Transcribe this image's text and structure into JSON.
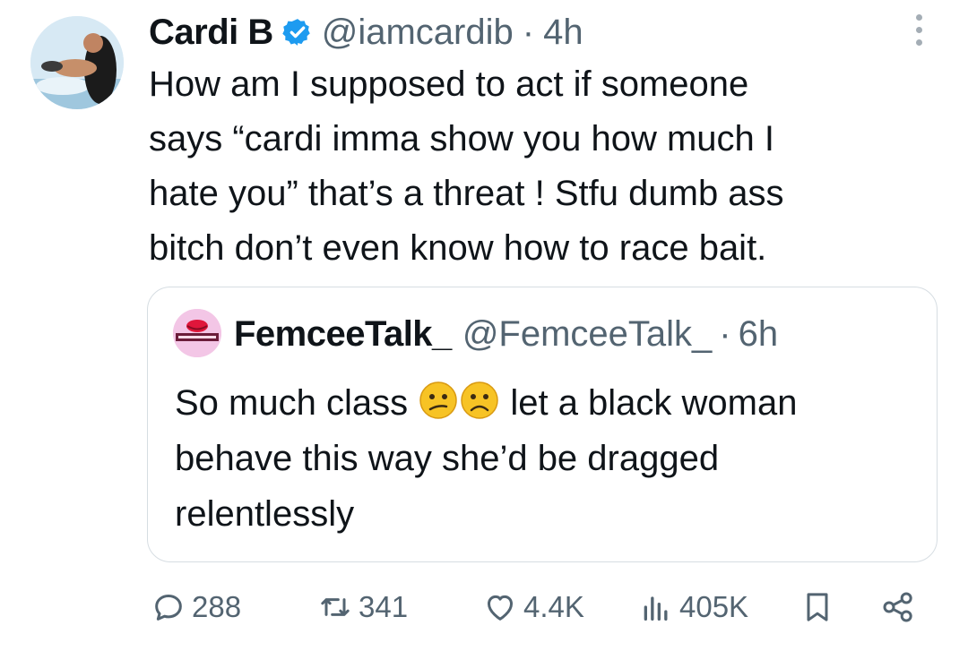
{
  "tweet": {
    "author_name": "Cardi B",
    "handle": "@iamcardib",
    "separator": "·",
    "time": "4h",
    "text": "How am I supposed to act if someone\nsays “cardi imma show you how much I\nhate you” that’s a threat ! Stfu dumb ass\nbitch don’t even know how to race bait."
  },
  "quote": {
    "author_name": "FemceeTalk_",
    "handle": "@FemceeTalk_",
    "separator": "·",
    "time": "6h",
    "text_before": "So much class ",
    "text_after": " let a black woman\nbehave this way she’d be dragged\nrelentlessly",
    "emojis": [
      "confused-face-emoji",
      "frowning-face-emoji"
    ]
  },
  "actions": {
    "replies": "288",
    "retweets": "341",
    "likes": "4.4K",
    "views": "405K"
  },
  "colors": {
    "text": "#0f1419",
    "muted": "#536471",
    "verified": "#1d9bf0",
    "border": "#d6dde2"
  }
}
